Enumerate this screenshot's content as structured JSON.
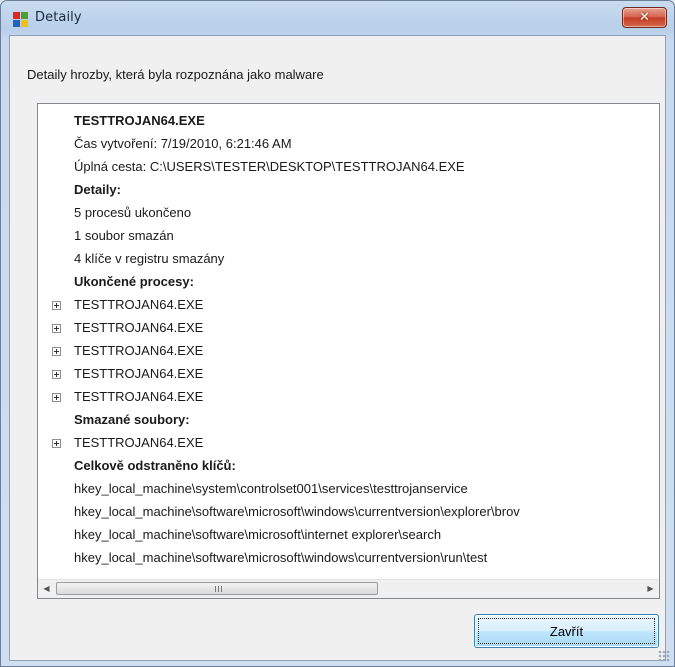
{
  "window": {
    "title": "Detaily",
    "close_symbol": "✕",
    "icon": "avg-logo-icon",
    "colors": {
      "logo_red": "#e4261c",
      "logo_green": "#4ca02e",
      "logo_blue": "#1f63c4",
      "logo_yellow": "#f7c011"
    }
  },
  "description": "Detaily hrozby, která byla rozpoznána jako malware",
  "tree": {
    "threat_name": "TESTTROJAN64.EXE",
    "created": "Čas vytvoření: 7/19/2010, 6:21:46 AM",
    "full_path": "Úplná cesta: C:\\USERS\\TESTER\\DESKTOP\\TESTTROJAN64.EXE",
    "details_heading": "Detaily:",
    "details": [
      "5 procesů ukončeno",
      "1 soubor smazán",
      "4 klíče v registru smazány"
    ],
    "processes_heading": "Ukončené procesy:",
    "processes": [
      "TESTTROJAN64.EXE",
      "TESTTROJAN64.EXE",
      "TESTTROJAN64.EXE",
      "TESTTROJAN64.EXE",
      "TESTTROJAN64.EXE"
    ],
    "files_heading": "Smazané soubory:",
    "files": [
      "TESTTROJAN64.EXE"
    ],
    "keys_heading": "Celkově odstraněno klíčů:",
    "keys": [
      "hkey_local_machine\\system\\controlset001\\services\\testtrojanservice",
      "hkey_local_machine\\software\\microsoft\\windows\\currentversion\\explorer\\brov",
      "hkey_local_machine\\software\\microsoft\\internet explorer\\search",
      "hkey_local_machine\\software\\microsoft\\windows\\currentversion\\run\\test"
    ]
  },
  "scrollbar": {
    "left_arrow": "◀",
    "right_arrow": "▶"
  },
  "close_button": "Zavřít"
}
